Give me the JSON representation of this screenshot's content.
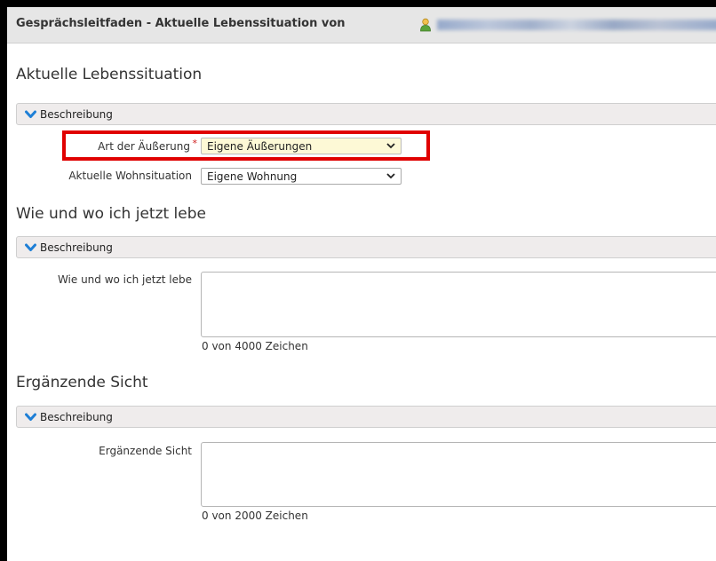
{
  "window": {
    "title": "Gesprächsleitfaden - Aktuelle Lebenssituation von"
  },
  "section1": {
    "heading": "Aktuelle Lebenssituation",
    "bar_label": "Beschreibung",
    "fields": {
      "art_label": "Art der Äußerung",
      "art_value": "Eigene Äußerungen",
      "wohn_label": "Aktuelle Wohnsituation",
      "wohn_value": "Eigene Wohnung"
    }
  },
  "section2": {
    "heading": "Wie und wo ich jetzt lebe",
    "bar_label": "Beschreibung",
    "field_label": "Wie und wo ich jetzt lebe",
    "counter": "0 von 4000 Zeichen"
  },
  "section3": {
    "heading": "Ergänzende Sicht",
    "bar_label": "Beschreibung",
    "field_label": "Ergänzende Sicht",
    "counter": "0 von 2000 Zeichen"
  },
  "required_marker": "*",
  "colors": {
    "accent": "#1e7fd6",
    "highlight_box": "#e00000",
    "required": "#d02020",
    "selected_field_bg": "#fdf9d6"
  },
  "icons": {
    "user": "user-icon",
    "chevron": "chevron-down-icon",
    "dropdown": "dropdown-arrow-icon"
  }
}
